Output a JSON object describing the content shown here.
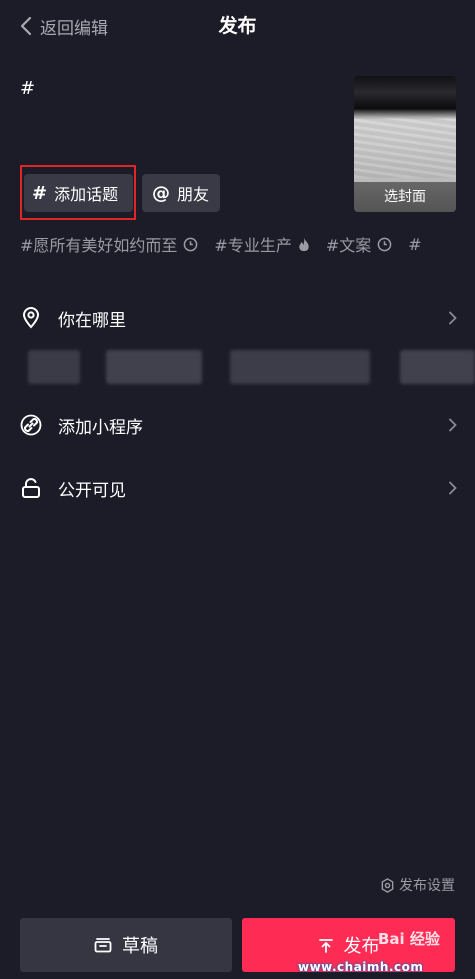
{
  "header": {
    "back_label": "返回编辑",
    "title": "发布"
  },
  "caption": {
    "value": "#"
  },
  "cover": {
    "label": "选封面"
  },
  "chips": {
    "topic_symbol": "#",
    "topic_label": "添加话题",
    "friend_symbol": "@",
    "friend_label": "朋友"
  },
  "suggested_tags": [
    {
      "label": "#愿所有美好如约而至",
      "icon": "clock-icon"
    },
    {
      "label": "#专业生产",
      "icon": "flame-icon"
    },
    {
      "label": "#文案",
      "icon": "clock-icon"
    },
    {
      "label": "#",
      "icon": ""
    }
  ],
  "options": {
    "location_label": "你在哪里",
    "mini_program_label": "添加小程序",
    "visibility_label": "公开可见"
  },
  "footer": {
    "settings_label": "发布设置",
    "draft_label": "草稿",
    "publish_label": "发布"
  },
  "watermarks": {
    "baidu": "Bai 经验",
    "site": "www.chaimh.com"
  },
  "colors": {
    "background": "#1c1c28",
    "chip_bg": "#3a3a46",
    "publish_red": "#fe2c55",
    "highlight_red": "#e02626"
  }
}
